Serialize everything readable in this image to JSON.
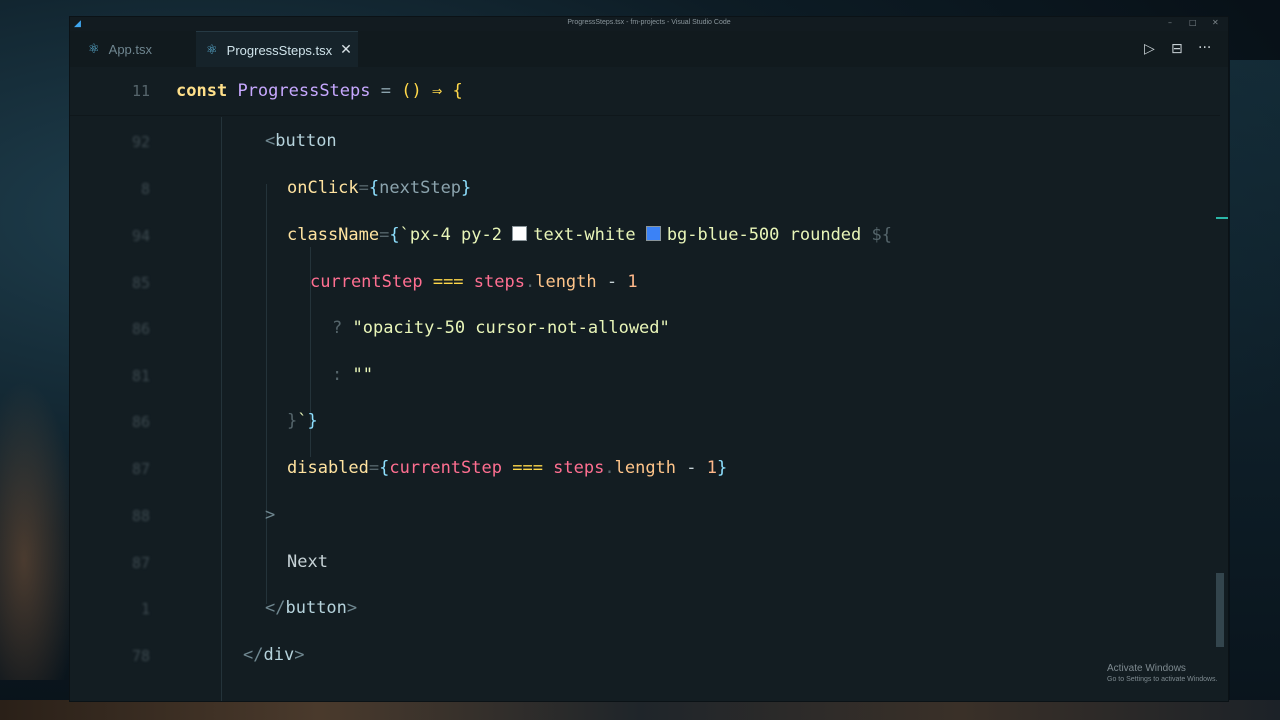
{
  "window": {
    "title": "ProgressSteps.tsx - fm-projects - Visual Studio Code",
    "controls": {
      "minimize": "–",
      "maximize": "□",
      "close": "✕"
    }
  },
  "tabs": [
    {
      "label": "App.tsx",
      "icon": "react-icon",
      "active": false
    },
    {
      "label": "ProgressSteps.tsx",
      "icon": "react-icon",
      "active": true,
      "close": "✕"
    }
  ],
  "toolbar": {
    "run": "▷",
    "split": "⊟",
    "more": "···"
  },
  "editor": {
    "sticky": {
      "line_no": "11",
      "kw": "const",
      "name": "ProgressSteps",
      "eq": "=",
      "parens": "()",
      "arrow": "⇒",
      "brace": "{"
    },
    "lines": {
      "l1": {
        "a": "<",
        "b": "button"
      },
      "l2": {
        "a": "onClick",
        "b": "=",
        "c": "{",
        "d": "nextStep",
        "e": "}"
      },
      "l3": {
        "a": "className",
        "b": "=",
        "c": "{",
        "d": "`px-4 py-2 ",
        "e": "text-white ",
        "f": "bg-blue-500 rounded ",
        "g": "${"
      },
      "l4": {
        "a": "currentStep",
        "b": " === ",
        "c": "steps",
        "d": ".",
        "e": "length",
        "f": " - ",
        "g": "1"
      },
      "l5": {
        "a": "? ",
        "b": "\"opacity-50 cursor-not-allowed\""
      },
      "l6": {
        "a": ": ",
        "b": "\"\""
      },
      "l7": {
        "a": "}",
        "b": "`",
        "c": "}"
      },
      "l8": {
        "a": "disabled",
        "b": "=",
        "c": "{",
        "d": "currentStep",
        "e": " === ",
        "f": "steps",
        "g": ".",
        "h": "length",
        "i": " - ",
        "j": "1",
        "k": "}"
      },
      "l9": {
        "a": ">"
      },
      "l10": {
        "a": "Next"
      },
      "l11": {
        "a": "</",
        "b": "button",
        "c": ">"
      },
      "l12": {
        "a": "</",
        "b": "div",
        "c": ">"
      }
    }
  },
  "colors": {
    "swatch_white": "#ffffff",
    "swatch_blue": "#3b82f6"
  },
  "watermark": {
    "title": "Activate Windows",
    "subtitle": "Go to Settings to activate Windows."
  }
}
